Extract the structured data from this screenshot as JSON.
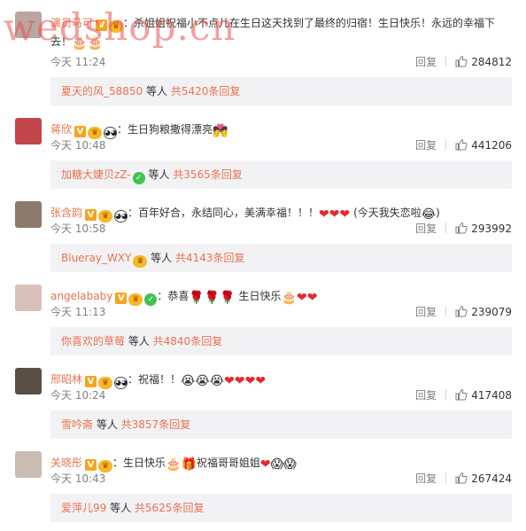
{
  "watermark": "wedshop.cn",
  "comments": [
    {
      "username": "演员马可",
      "text_a": "：杀姐姐祝福小不点儿在生日这天找到了最终的归宿！生日快乐！永远的幸福下去！",
      "time": "今天 11:24",
      "reply_label": "回复",
      "likes": "284812",
      "sub_user": "夏天的风_58850",
      "sub_mid": " 等人 ",
      "sub_count": "共5420条回复",
      "avatar_color": "#b9a6a0"
    },
    {
      "username": "蒋欣",
      "text_a": "：生日狗粮撒得漂亮",
      "time": "今天 10:48",
      "reply_label": "回复",
      "likes": "441206",
      "sub_user": "加糖大婕贝zZ-",
      "sub_mid": " 等人 ",
      "sub_count": "共3565条回复",
      "avatar_color": "#c2464a"
    },
    {
      "username": "张含韵",
      "text_a": "：百年好合，永结同心，美满幸福！！！",
      "text_b": "(今天我失恋啦",
      "text_c": ")",
      "time": "今天 10:58",
      "reply_label": "回复",
      "likes": "293992",
      "sub_user": "Blueray_WXY",
      "sub_mid": " 等人 ",
      "sub_count": "共4143条回复",
      "avatar_color": "#8c7a6a"
    },
    {
      "username": "angelababy",
      "text_a": "：恭喜",
      "text_b": "生日快乐",
      "time": "今天 11:13",
      "reply_label": "回复",
      "likes": "239079",
      "sub_user": "你喜欢的草莓",
      "sub_mid": " 等人 ",
      "sub_count": "共4840条回复",
      "avatar_color": "#d9c1bb"
    },
    {
      "username": "邢昭林",
      "text_a": "：祝福！！",
      "time": "今天 10:24",
      "reply_label": "回复",
      "likes": "417408",
      "sub_user": "雪吟斋",
      "sub_mid": " 等人 ",
      "sub_count": "共3857条回复",
      "avatar_color": "#5a4f45"
    },
    {
      "username": "关晓彤",
      "text_a": "：生日快乐",
      "text_b": "祝福哥哥姐姐",
      "time": "今天 10:43",
      "reply_label": "回复",
      "likes": "267424",
      "sub_user": "爱萍儿99",
      "sub_mid": " 等人 ",
      "sub_count": "共5625条回复",
      "avatar_color": "#c9bdb3"
    }
  ],
  "colors": {
    "link": "#eb7350",
    "meta": "#808080",
    "sub_bg": "#f2f2f5"
  },
  "icons": {
    "verified": "V",
    "like": "thumbs-up-icon"
  }
}
